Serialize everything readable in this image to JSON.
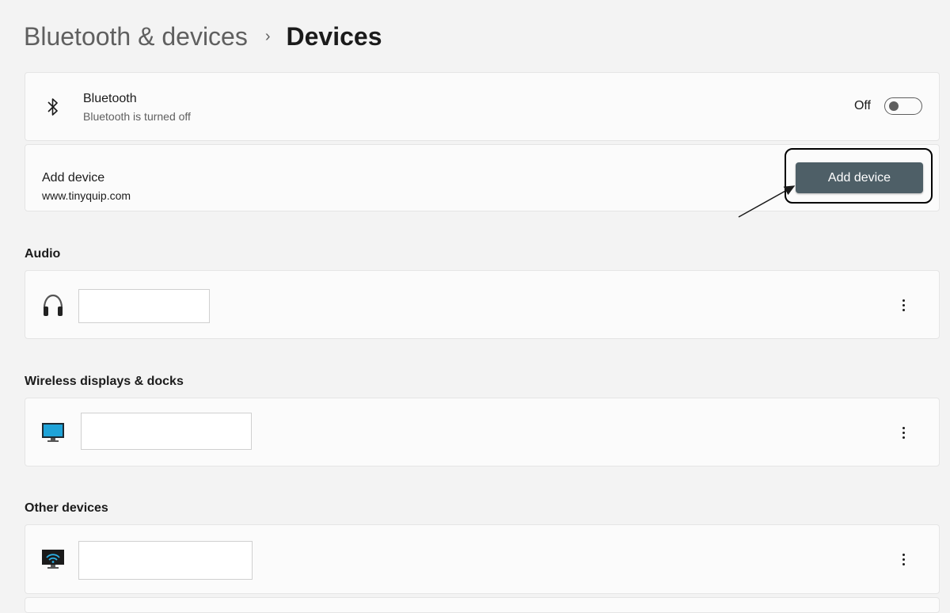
{
  "breadcrumb": {
    "parent": "Bluetooth & devices",
    "separator": "›",
    "current": "Devices"
  },
  "bluetooth": {
    "icon": "bluetooth-icon",
    "title": "Bluetooth",
    "subtitle": "Bluetooth is turned off",
    "toggle_label": "Off",
    "toggle_on": false
  },
  "add_device": {
    "title": "Add device",
    "subtitle": "www.tinyquip.com",
    "button_label": "Add device",
    "button_color": "#4e5f67"
  },
  "sections": {
    "audio": {
      "title": "Audio",
      "icon": "headphones-icon",
      "device_name": ""
    },
    "wireless": {
      "title": "Wireless displays & docks",
      "icon": "monitor-icon",
      "device_name": ""
    },
    "other": {
      "title": "Other devices",
      "icon": "wireless-display-icon",
      "device_name": ""
    }
  },
  "colors": {
    "background": "#f3f3f3",
    "card": "#fbfbfb",
    "accent_button": "#4e5f67"
  }
}
